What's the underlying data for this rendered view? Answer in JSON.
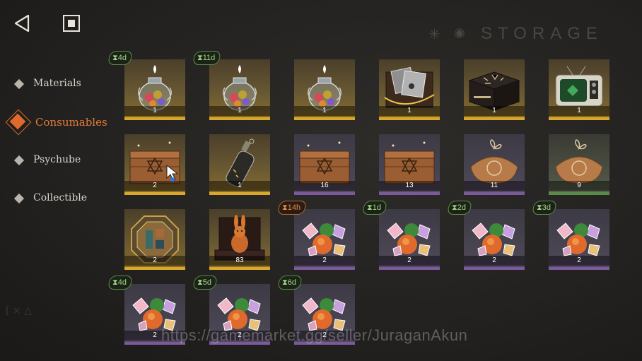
{
  "header": {
    "title": "STORAGE",
    "title_sun_glyph": "✳",
    "title_eye_glyph": "◉"
  },
  "sidebar": {
    "items": [
      {
        "label": "Materials",
        "active": false
      },
      {
        "label": "Consumables",
        "active": true
      },
      {
        "label": "Psychube",
        "active": false
      },
      {
        "label": "Collectible",
        "active": false
      }
    ]
  },
  "colors": {
    "accent": "#e06a2c",
    "gold": "#d9a82a",
    "purple": "#7a5a9a",
    "green": "#5c8a4a",
    "timer_green": "#9fd487",
    "timer_orange": "#e88a4a"
  },
  "inventory": [
    {
      "qty": "1",
      "icon": "candy-jar-icon",
      "timer": "⧗4d",
      "timer_color": "green",
      "rarity": "gold"
    },
    {
      "qty": "1",
      "icon": "candy-jar-icon",
      "timer": "⧗11d",
      "timer_color": "green",
      "rarity": "gold"
    },
    {
      "qty": "1",
      "icon": "candy-jar-icon",
      "timer": "",
      "timer_color": "",
      "rarity": "gold"
    },
    {
      "qty": "1",
      "icon": "photo-box-icon",
      "timer": "",
      "timer_color": "",
      "rarity": "gold"
    },
    {
      "qty": "1",
      "icon": "rune-chest-icon",
      "timer": "",
      "timer_color": "",
      "rarity": "gold"
    },
    {
      "qty": "1",
      "icon": "retro-tv-icon",
      "timer": "",
      "timer_color": "",
      "rarity": "gold"
    },
    {
      "qty": "2",
      "icon": "wooden-crate-icon",
      "timer": "",
      "timer_color": "",
      "rarity": "gold"
    },
    {
      "qty": "1",
      "icon": "bottle-icon",
      "timer": "",
      "timer_color": "",
      "rarity": "gold"
    },
    {
      "qty": "16",
      "icon": "wooden-crate-icon",
      "timer": "",
      "timer_color": "",
      "rarity": "purple"
    },
    {
      "qty": "13",
      "icon": "wooden-crate-icon",
      "timer": "",
      "timer_color": "",
      "rarity": "purple"
    },
    {
      "qty": "11",
      "icon": "parcel-icon",
      "timer": "",
      "timer_color": "",
      "rarity": "purple"
    },
    {
      "qty": "9",
      "icon": "parcel-icon",
      "timer": "",
      "timer_color": "",
      "rarity": "green"
    },
    {
      "qty": "2",
      "icon": "octagon-emblem-icon",
      "timer": "",
      "timer_color": "",
      "rarity": "gold"
    },
    {
      "qty": "83",
      "icon": "rabbit-figurine-icon",
      "timer": "",
      "timer_color": "",
      "rarity": "gold"
    },
    {
      "qty": "2",
      "icon": "candy-pile-icon",
      "timer": "⧗14h",
      "timer_color": "orange",
      "rarity": "purple"
    },
    {
      "qty": "2",
      "icon": "candy-pile-icon",
      "timer": "⧗1d",
      "timer_color": "green",
      "rarity": "purple"
    },
    {
      "qty": "2",
      "icon": "candy-pile-icon",
      "timer": "⧗2d",
      "timer_color": "green",
      "rarity": "purple"
    },
    {
      "qty": "2",
      "icon": "candy-pile-icon",
      "timer": "⧗3d",
      "timer_color": "green",
      "rarity": "purple"
    },
    {
      "qty": "2",
      "icon": "candy-pile-icon",
      "timer": "⧗4d",
      "timer_color": "green",
      "rarity": "purple"
    },
    {
      "qty": "2",
      "icon": "candy-pile-icon",
      "timer": "⧗5d",
      "timer_color": "green",
      "rarity": "purple"
    },
    {
      "qty": "2",
      "icon": "candy-pile-icon",
      "timer": "⧗6d",
      "timer_color": "green",
      "rarity": "purple"
    }
  ],
  "watermark": "https://gamemarket.gg/seller/JuraganAkun",
  "corner_mark": "[ × △"
}
